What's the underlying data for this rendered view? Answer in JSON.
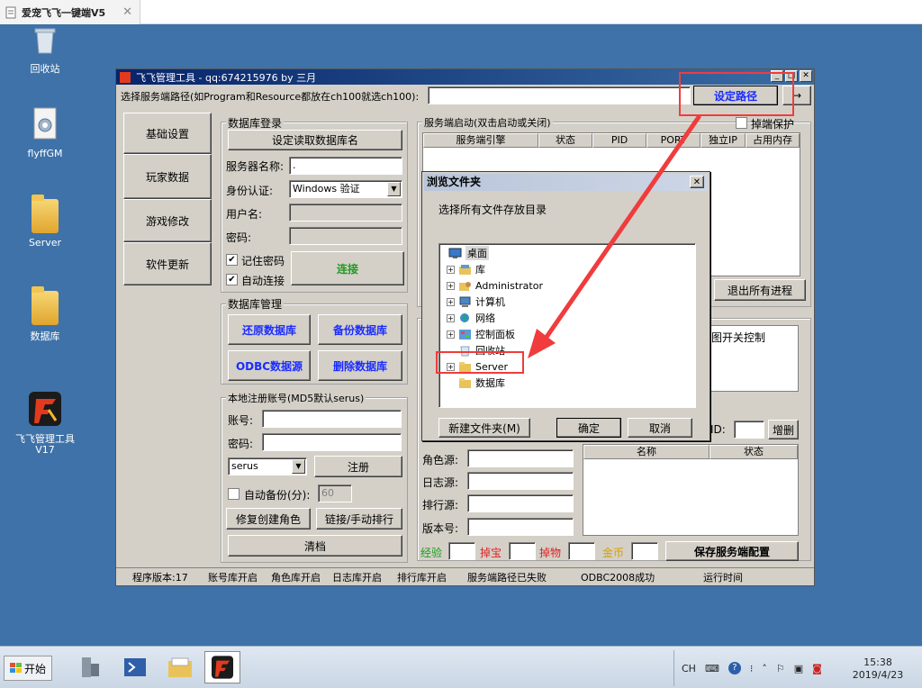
{
  "vm_tab": {
    "title": "爱宠飞飞一键端V5",
    "close": "✕"
  },
  "desktop_icons": [
    {
      "label": "回收站"
    },
    {
      "label": "flyffGM"
    },
    {
      "label": "Server"
    },
    {
      "label": "数据库"
    },
    {
      "label": "飞飞管理工具\nV17"
    }
  ],
  "window": {
    "title": "飞飞管理工具 - qq:674215976    by 三月",
    "path_label": "选择服务端路径(如Program和Resource都放在ch100就选ch100):",
    "path_value": "",
    "set_path_button": "设定路径",
    "arrow_button": "→",
    "sidebar": [
      "基础设置",
      "玩家数据",
      "游戏修改",
      "软件更新"
    ],
    "db_login": {
      "title": "数据库登录",
      "read_button": "设定读取数据库名",
      "server_label": "服务器名称:",
      "server_value": ".",
      "auth_label": "身份认证:",
      "auth_value": "Windows 验证",
      "user_label": "用户名:",
      "password_label": "密码:",
      "remember_label": "记住密码",
      "autoconnect_label": "自动连接",
      "connect_button": "连接",
      "check": "✔"
    },
    "db_manage": {
      "title": "数据库管理",
      "buttons": [
        "还原数据库",
        "备份数据库",
        "ODBC数据源",
        "删除数据库"
      ]
    },
    "local_reg": {
      "title": "本地注册账号(MD5默认serus)",
      "account_label": "账号:",
      "password_label": "密码:",
      "type_value": "serus",
      "register_button": "注册",
      "autobackup_label": "自动备份(分):",
      "autobackup_value": "60",
      "repair_button": "修复创建角色",
      "link_button": "链接/手动排行",
      "clear_button": "清档"
    },
    "server_start": {
      "title": "服务端启动(双击启动或关闭)",
      "protect_label": "掉端保护",
      "columns": [
        "服务端引擎",
        "状态",
        "PID",
        "PORT",
        "独立IP",
        "占用内存"
      ],
      "exit_all_button": "退出所有进程"
    },
    "partial": {
      "map_switch": "图开关控制",
      "id_label": "ID:",
      "add_delete_button": "增删",
      "role_src": "角色源:",
      "log_src": "日志源:",
      "rank_src": "排行源:",
      "version": "版本号:",
      "list_columns": [
        "名称",
        "状态"
      ],
      "exp_label": "经验",
      "treasure_label": "掉宝",
      "drop_label": "掉物",
      "gold_label": "金币",
      "save_config_button": "保存服务端配置"
    },
    "status_bar": [
      "程序版本:17",
      "账号库开启",
      "角色库开启",
      "日志库开启",
      "排行库开启",
      "服务端路径已失败",
      "ODBC2008成功",
      "运行时间"
    ]
  },
  "dialog": {
    "title": "浏览文件夹",
    "close": "✕",
    "instruction": "选择所有文件存放目录",
    "tree": [
      {
        "label": "桌面",
        "level": 0,
        "expand": ""
      },
      {
        "label": "库",
        "level": 1,
        "expand": "+"
      },
      {
        "label": "Administrator",
        "level": 1,
        "expand": "+"
      },
      {
        "label": "计算机",
        "level": 1,
        "expand": "+"
      },
      {
        "label": "网络",
        "level": 1,
        "expand": "+"
      },
      {
        "label": "控制面板",
        "level": 1,
        "expand": "+"
      },
      {
        "label": "回收站",
        "level": 1,
        "expand": ""
      },
      {
        "label": "Server",
        "level": 1,
        "expand": "+"
      },
      {
        "label": "数据库",
        "level": 1,
        "expand": ""
      }
    ],
    "new_folder_button": "新建文件夹(M)",
    "ok_button": "确定",
    "cancel_button": "取消"
  },
  "taskbar": {
    "start_label": "开始",
    "tray_lang": "CH",
    "time": "15:38",
    "date": "2019/4/23"
  },
  "colors": {
    "desktop": "#3e72a8",
    "title_active": "#07246a",
    "highlight_red": "#f03c3c",
    "button_text_blue": "#1a2cff"
  }
}
